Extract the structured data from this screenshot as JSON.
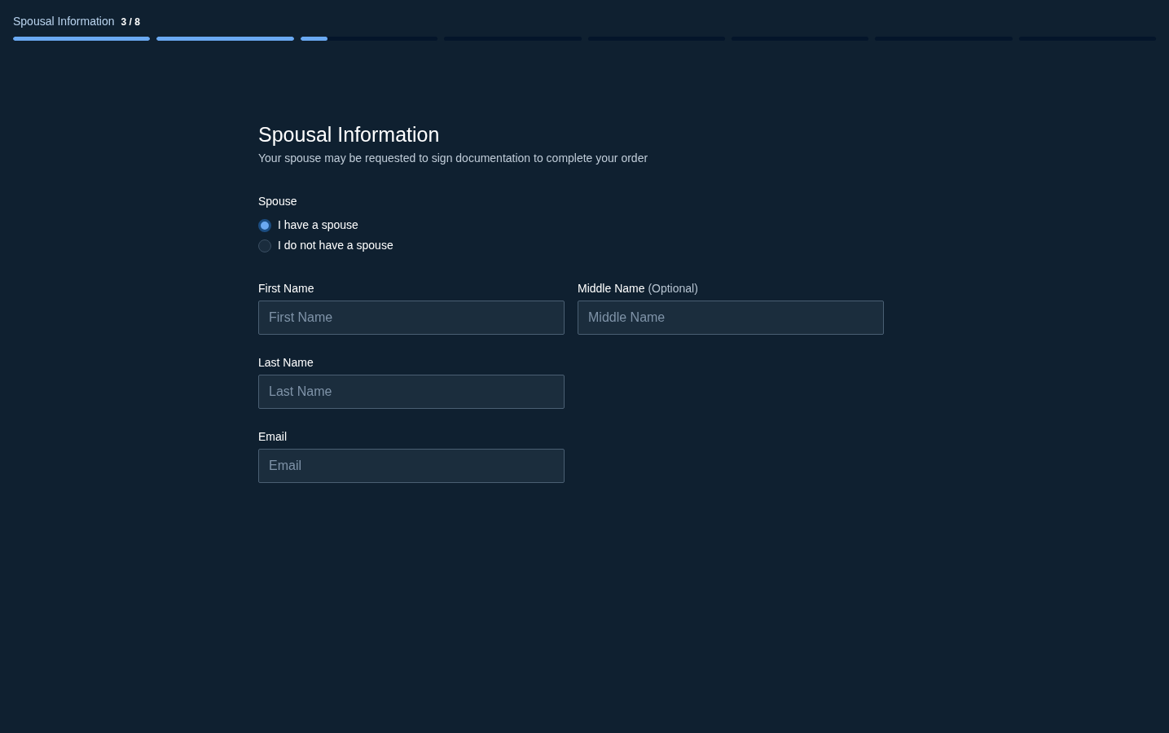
{
  "progress": {
    "title": "Spousal Information",
    "step": "3 / 8",
    "segments": [
      {
        "level": 1
      },
      {
        "level": 1
      },
      {
        "level": 0.2
      },
      {
        "level": 0
      },
      {
        "level": 0
      },
      {
        "level": 0
      },
      {
        "level": 0
      },
      {
        "level": 0
      }
    ]
  },
  "heading": "Spousal Information",
  "subtitle": "Your spouse may be requested to sign documentation to complete your order",
  "spouse": {
    "label": "Spouse",
    "options": [
      {
        "label": "I have a spouse",
        "selected": true
      },
      {
        "label": "I do not have a spouse",
        "selected": false
      }
    ]
  },
  "field_rows": [
    [
      {
        "label": "First Name",
        "placeholder": "First Name"
      },
      {
        "label": "Middle Name",
        "note": "(Optional)",
        "placeholder": "Middle Name"
      }
    ],
    [
      {
        "label": "Last Name",
        "placeholder": "Last Name"
      }
    ],
    [
      {
        "label": "Email",
        "placeholder": "Email"
      }
    ]
  ]
}
